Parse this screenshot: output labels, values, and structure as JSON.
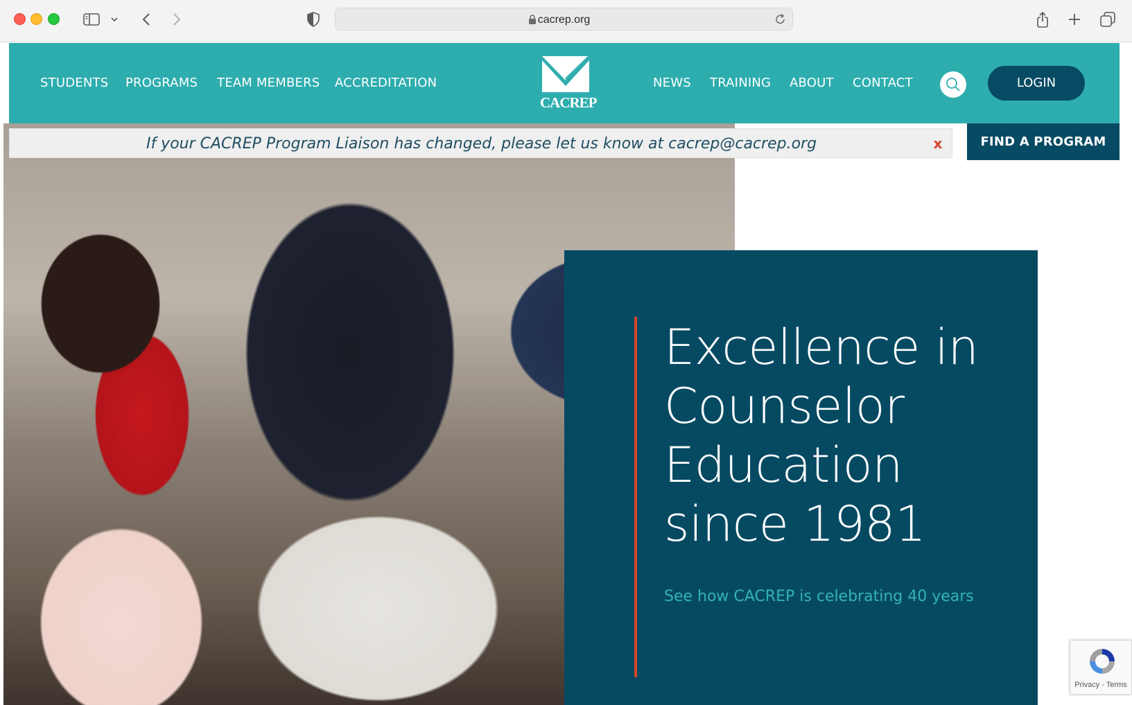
{
  "browser": {
    "url": "cacrep.org"
  },
  "nav": {
    "left_items": [
      {
        "label": "STUDENTS"
      },
      {
        "label": "PROGRAMS"
      },
      {
        "label": "TEAM MEMBERS"
      },
      {
        "label": "ACCREDITATION"
      }
    ],
    "right_items": [
      {
        "label": "NEWS"
      },
      {
        "label": "TRAINING"
      },
      {
        "label": "ABOUT"
      },
      {
        "label": "CONTACT"
      }
    ],
    "logo_text": "CACREP",
    "login_label": "LOGIN"
  },
  "alert": {
    "message": "If your CACREP Program Liaison has changed, please let us know at cacrep@cacrep.org",
    "close_label": "x"
  },
  "find_program_label": "FIND A PROGRAM",
  "hero": {
    "headline_lines": [
      "Excellence in",
      "Counselor",
      "Education",
      "since 1981"
    ],
    "sublink": "See how CACREP is celebrating 40 years"
  },
  "recaptcha": {
    "links": "Privacy - Terms"
  },
  "colors": {
    "nav_teal": "#2eadae",
    "dark_navy": "#064a62",
    "accent_red": "#d6452a",
    "link_teal": "#34b3b3"
  }
}
